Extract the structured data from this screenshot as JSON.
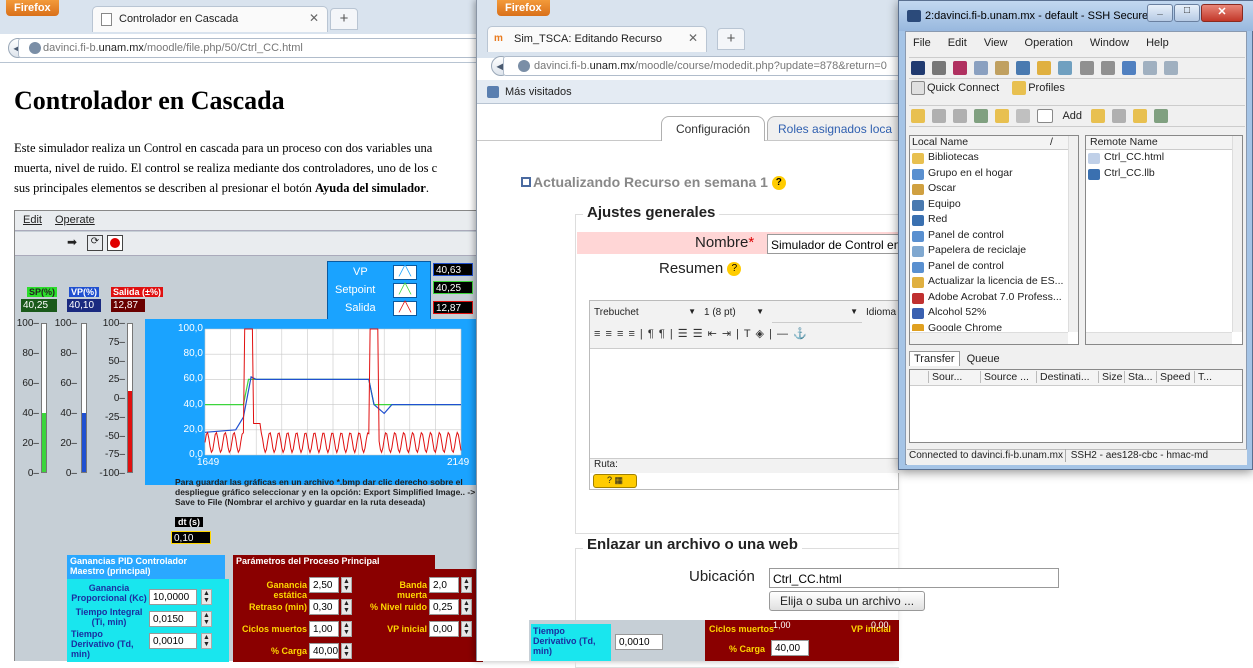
{
  "win1": {
    "firefox": "Firefox",
    "tab": "Controlador en Cascada",
    "url_host": "davinci.fi-b.",
    "url_domain": "unam.mx",
    "url_path": "/moodle/file.php/50/Ctrl_CC.html",
    "heading": "Controlador en Cascada",
    "para1": "Este simulador realiza un Control en cascada para un proceso con dos variables una",
    "para2": "muerta, nivel de ruido. El control se realiza mediante dos controladores, uno de los c",
    "para3a": "sus principales elementos se describen al presionar el botón ",
    "para3b": "Ayuda del simulador",
    "para3c": ".",
    "lv_menu": [
      "Edit",
      "Operate"
    ],
    "legend": [
      {
        "name": "VP",
        "value": "40,63"
      },
      {
        "name": "Setpoint",
        "value": "40,25"
      },
      {
        "name": "Salida",
        "value": "12,87"
      }
    ],
    "gauges": [
      {
        "label": "SP(%)",
        "value": "40,25",
        "ticks": [
          "100",
          "80",
          "60",
          "40",
          "20",
          "0"
        ],
        "fill": 0.4,
        "color": "#3cd53c"
      },
      {
        "label": "VP(%)",
        "value": "40,10",
        "ticks": [
          "100",
          "80",
          "60",
          "40",
          "20",
          "0"
        ],
        "fill": 0.4,
        "color": "#2050d0"
      },
      {
        "label": "Salida (±%)",
        "value": "12,87",
        "ticks": [
          "100",
          "75",
          "50",
          "25",
          "0",
          "-25",
          "-50",
          "-75",
          "-100"
        ],
        "fill": 0.55,
        "color": "#e01010"
      }
    ],
    "chart_y_ticks": [
      "100,0",
      "80,0",
      "60,0",
      "40,0",
      "20,0",
      "0,0"
    ],
    "chart_x_ticks": [
      "1649",
      "2149"
    ],
    "save_note": "Para guardar las gráficas en un archivo *.bmp dar clic derecho sobre el despliegue gráfico seleccionar y en la opción: Export Simplified Image.. -> Save to File (Nombrar el archivo y guardar en la ruta deseada)",
    "dt_label": "dt (s)",
    "dt_value": "0,10",
    "pid_title": "Ganancias PID Controlador Maestro (principal)",
    "pid": [
      {
        "label": "Ganancia Proporcional (Kc)",
        "value": "10,0000"
      },
      {
        "label": "Tiempo Integral (Ti, min)",
        "value": "0,0150"
      },
      {
        "label": "Tiempo Derivativo (Td, min)",
        "value": "0,0010"
      }
    ],
    "proc_title": "Parámetros del Proceso Principal",
    "proc_left": [
      {
        "label": "Ganancia estática",
        "value": "2,50"
      },
      {
        "label": "Retraso (min)",
        "value": "0,30"
      },
      {
        "label": "Ciclos muertos",
        "value": "1,00"
      },
      {
        "label": "% Carga",
        "value": "40,00"
      }
    ],
    "proc_right": [
      {
        "label": "Banda muerta",
        "value": "2,0"
      },
      {
        "label": "% Nivel ruido",
        "value": "0,25"
      },
      {
        "label": "VP inicial",
        "value": "0,00"
      }
    ]
  },
  "win2": {
    "firefox": "Firefox",
    "tab": "Sim_TSCA: Editando Recurso",
    "url_host": "davinci.fi-b.",
    "url_domain": "unam.mx",
    "url_path": "/moodle/course/modedit.php?update=878&return=0",
    "bookmarks": "Más visitados",
    "tabs": [
      "Configuración",
      "Roles asignados loca"
    ],
    "title": "Actualizando Recurso en semana 1",
    "section1": "Ajustes generales",
    "nombre_label": "Nombre",
    "nombre_value": "Simulador de Control en",
    "resumen_label": "Resumen",
    "font": "Trebuchet",
    "size": "1 (8 pt)",
    "lang": "Idioma",
    "ruta": "Ruta:",
    "section2": "Enlazar un archivo o una web",
    "ubic_label": "Ubicación",
    "ubic_value": "Ctrl_CC.html",
    "choose_btn": "Elija o suba un archivo ...",
    "bottom_td": "Tiempo Derivativo (Td, min)",
    "bottom_td_value": "0,0010",
    "bottom_ciclos": "Ciclos muertos",
    "bottom_vp": "VP inicial",
    "bottom_vp_val": "0,00",
    "bottom_carga": "% Carga",
    "bottom_carga_val": "40,00",
    "bottom_ciclos_val": "1,00"
  },
  "win3": {
    "title": "2:davinci.fi-b.unam.mx - default - SSH Secure ...",
    "menu": [
      "File",
      "Edit",
      "View",
      "Operation",
      "Window",
      "Help"
    ],
    "quick": "Quick Connect",
    "profiles": "Profiles",
    "add": "Add",
    "local_header": "Local Name",
    "remote_header": "Remote Name",
    "local": [
      "Bibliotecas",
      "Grupo en el hogar",
      "Oscar",
      "Equipo",
      "Red",
      "Panel de control",
      "Papelera de reciclaje",
      "Panel de control",
      "Actualizar la licencia de ES...",
      "Adobe Acrobat 7.0 Profess...",
      "Alcohol 52%",
      "Google Chrome"
    ],
    "remote": [
      "Ctrl_CC.html",
      "Ctrl_CC.llb"
    ],
    "transfer_tabs": [
      "Transfer",
      "Queue"
    ],
    "cols": [
      "Sour...",
      "Source ...",
      "Destinati...",
      "Size",
      "Sta...",
      "Speed",
      "T..."
    ],
    "status1": "Connected to davinci.fi-b.unam.mx",
    "status2": "SSH2 - aes128-cbc - hmac-md"
  },
  "colors": {
    "firefox": "#e8751a",
    "lv_bg": "#c6cfd6",
    "chart_bg": "#1aa3ff",
    "plot_bg": "#ffffff",
    "red_panel": "#8a0000",
    "cyan_panel": "#19e6ee",
    "title_bar": "#a5c4e6"
  }
}
